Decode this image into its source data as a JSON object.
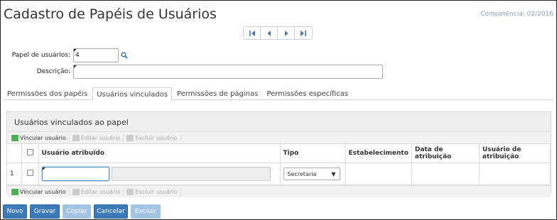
{
  "page": {
    "title": "Cadastro de Papéis de Usuários",
    "competencia": "Competência: 02/2016"
  },
  "nav": {
    "icons": [
      "first-record-icon",
      "previous-record-icon",
      "next-record-icon",
      "last-record-icon"
    ]
  },
  "form": {
    "papel_label": "Papel de usuários:",
    "papel_value": "4",
    "descricao_label": "Descrição:",
    "descricao_value": ""
  },
  "tabs": [
    {
      "label": "Permissões dos papéis",
      "active": false
    },
    {
      "label": "Usuários vinculados",
      "active": true
    },
    {
      "label": "Permissões de páginas",
      "active": false
    },
    {
      "label": "Permissões específicas",
      "active": false
    }
  ],
  "panel": {
    "title": "Usuários vinculados ao papel",
    "toolbar": {
      "vincular": "Vincular usuário",
      "editar": "Editar usuário",
      "excluir": "Excluir usuário"
    },
    "columns": [
      "Usuário atribuído",
      "Tipo",
      "Estabelecimento",
      "Data de atribuição",
      "Usuário de atribuição"
    ],
    "rows": [
      {
        "num": "1",
        "usuario": "",
        "usuario_desc": "",
        "tipo": "Secretaria",
        "estabelecimento": "",
        "data": "",
        "usuario_atrib": ""
      }
    ]
  },
  "buttons": {
    "novo": "Novo",
    "gravar": "Gravar",
    "copiar": "Copiar",
    "cancelar": "Cancelar",
    "excluir": "Excluir"
  },
  "colors": {
    "accent": "#3d7ab8",
    "disabled": "#a3c4e2",
    "add_icon": "#4caf50"
  }
}
